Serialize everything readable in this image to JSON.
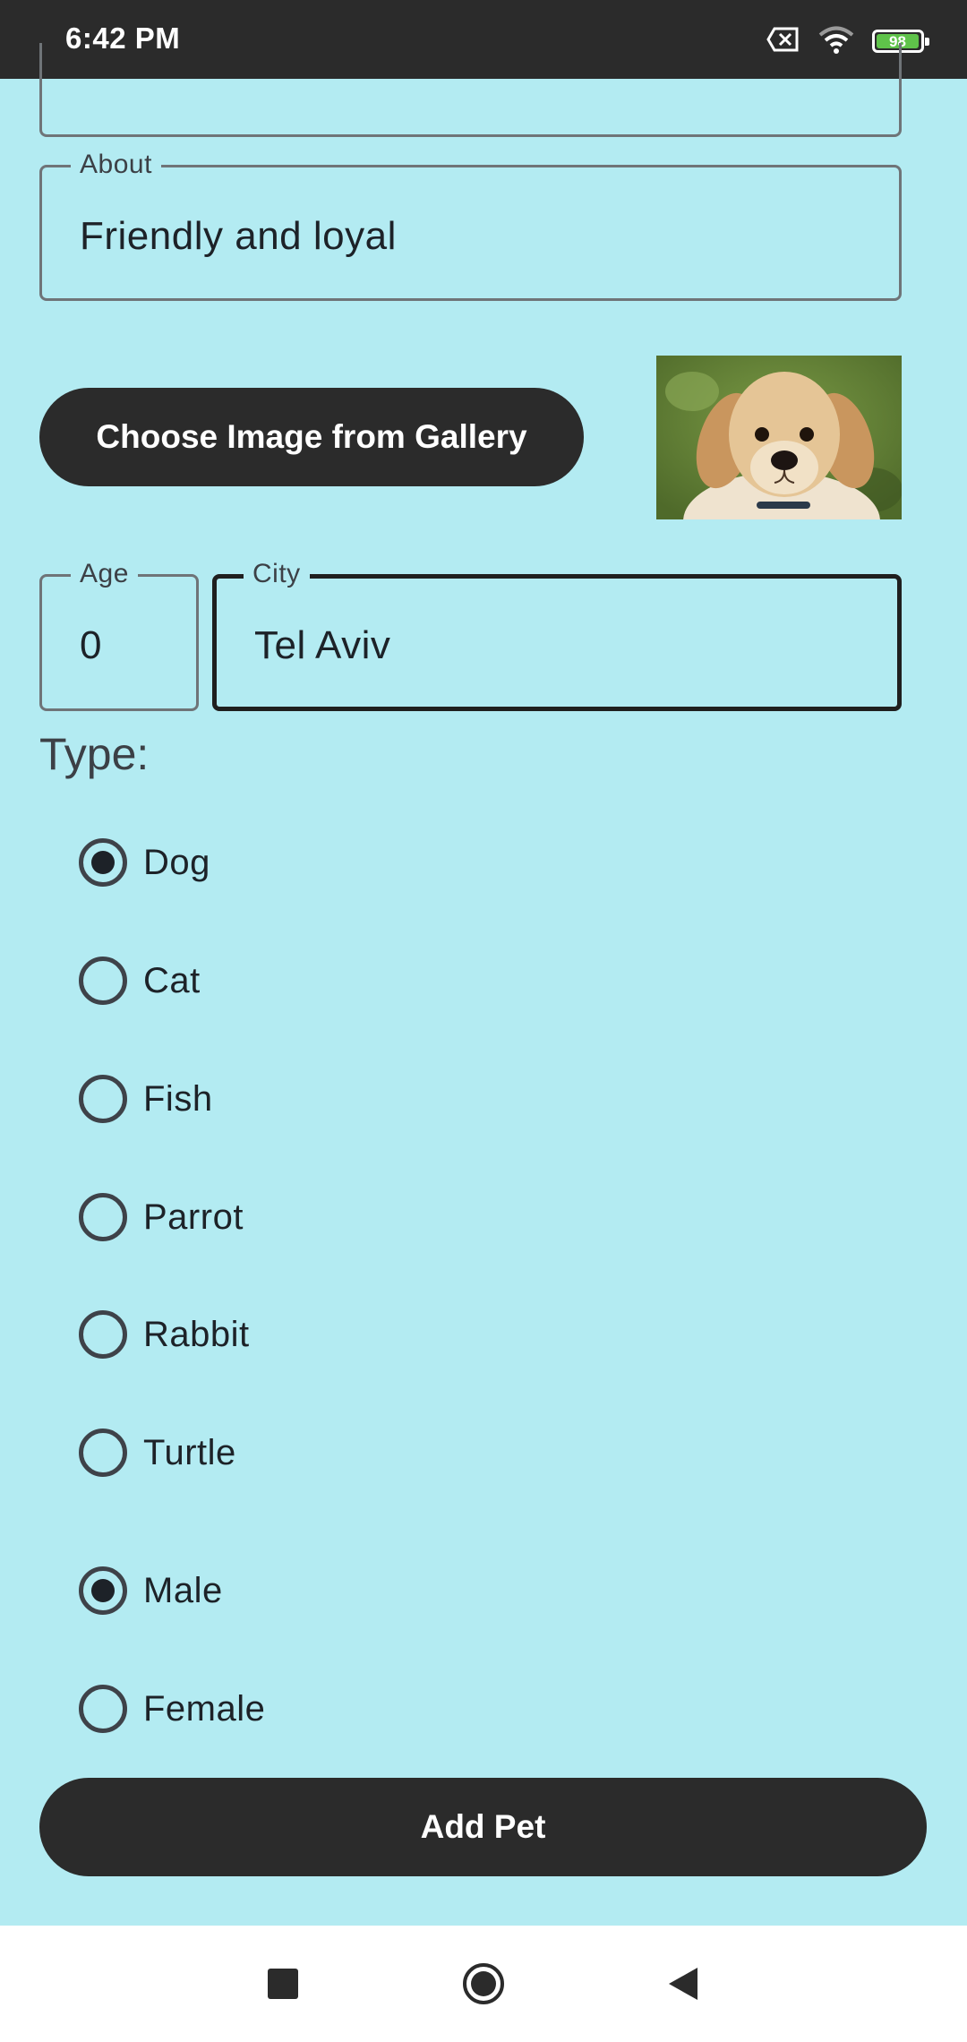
{
  "status_bar": {
    "time": "6:42 PM",
    "battery_level": "98",
    "icons": [
      "sim-off-icon",
      "wifi-icon",
      "battery-icon"
    ]
  },
  "form": {
    "about": {
      "label": "About",
      "value": "Friendly and loyal"
    },
    "choose_image_label": "Choose Image from Gallery",
    "age": {
      "label": "Age",
      "value": "0"
    },
    "city": {
      "label": "City",
      "value": "Tel Aviv"
    },
    "type_title": "Type:",
    "types": [
      {
        "label": "Dog",
        "selected": true
      },
      {
        "label": "Cat",
        "selected": false
      },
      {
        "label": "Fish",
        "selected": false
      },
      {
        "label": "Parrot",
        "selected": false
      },
      {
        "label": "Rabbit",
        "selected": false
      },
      {
        "label": "Turtle",
        "selected": false
      }
    ],
    "genders": [
      {
        "label": "Male",
        "selected": true
      },
      {
        "label": "Female",
        "selected": false
      }
    ],
    "add_pet_label": "Add Pet"
  },
  "nav_bar": {
    "icons": [
      "recents-icon",
      "home-icon",
      "back-icon"
    ]
  },
  "colors": {
    "background": "#b3ebf2",
    "button": "#2b2b2b",
    "status_bar": "#2b2b2b",
    "battery": "#5fc34a"
  }
}
